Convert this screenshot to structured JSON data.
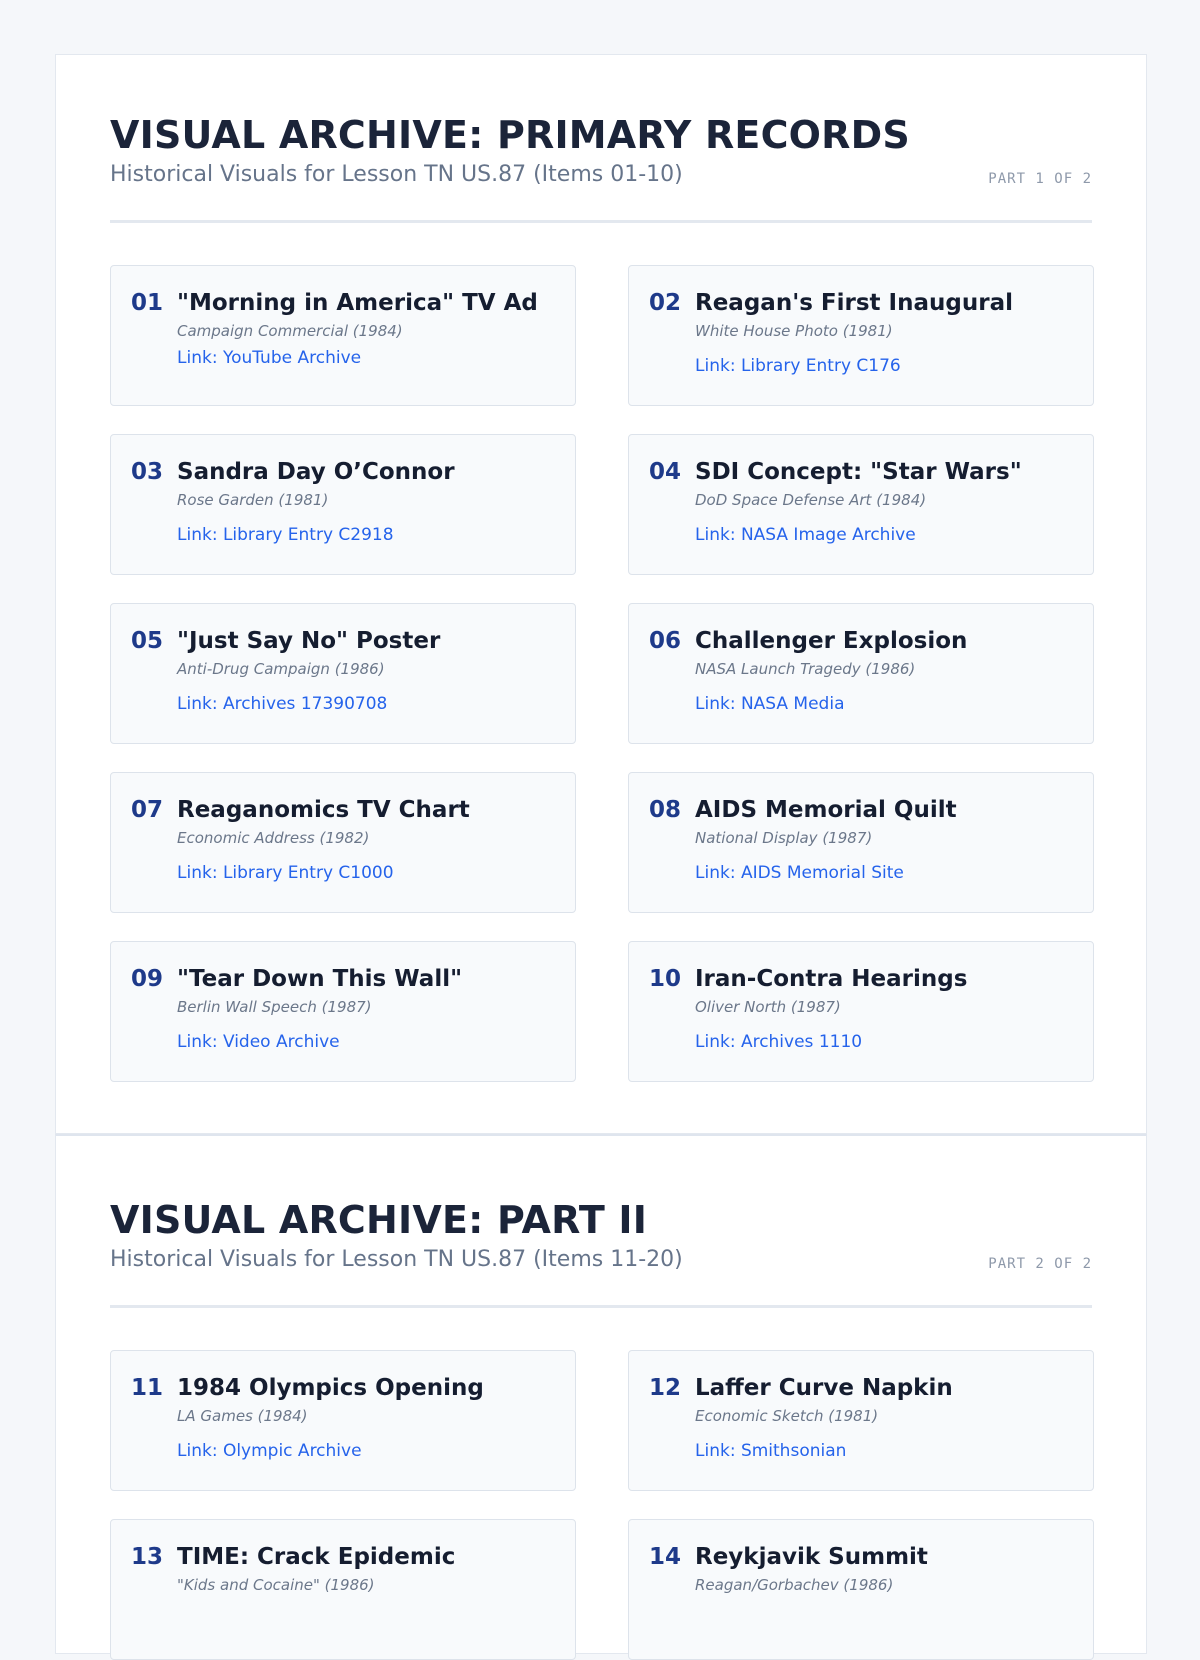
{
  "sections": [
    {
      "title": "VISUAL ARCHIVE: PRIMARY RECORDS",
      "subtitle": "Historical Visuals for Lesson TN US.87 (Items 01-10)",
      "part": "PART 1 OF 2",
      "items": [
        {
          "num": "01",
          "title": "\"Morning in America\" TV Ad",
          "meta": "Campaign Commercial (1984)",
          "link": "Link: YouTube Archive"
        },
        {
          "num": "02",
          "title": "Reagan's First Inaugural",
          "meta": "White House Photo (1981)",
          "link": "Link: Library Entry C176"
        },
        {
          "num": "03",
          "title": "Sandra Day O’Connor",
          "meta": "Rose Garden (1981)",
          "link": "Link: Library Entry C2918"
        },
        {
          "num": "04",
          "title": "SDI Concept: \"Star Wars\"",
          "meta": "DoD Space Defense Art (1984)",
          "link": "Link: NASA Image Archive"
        },
        {
          "num": "05",
          "title": "\"Just Say No\" Poster",
          "meta": "Anti-Drug Campaign (1986)",
          "link": "Link: Archives 17390708"
        },
        {
          "num": "06",
          "title": "Challenger Explosion",
          "meta": "NASA Launch Tragedy (1986)",
          "link": "Link: NASA Media"
        },
        {
          "num": "07",
          "title": "Reaganomics TV Chart",
          "meta": "Economic Address (1982)",
          "link": "Link: Library Entry C1000"
        },
        {
          "num": "08",
          "title": "AIDS Memorial Quilt",
          "meta": "National Display (1987)",
          "link": "Link: AIDS Memorial Site"
        },
        {
          "num": "09",
          "title": "\"Tear Down This Wall\"",
          "meta": "Berlin Wall Speech (1987)",
          "link": "Link: Video Archive"
        },
        {
          "num": "10",
          "title": "Iran-Contra Hearings",
          "meta": "Oliver North (1987)",
          "link": "Link: Archives 1110"
        }
      ]
    },
    {
      "title": "VISUAL ARCHIVE: PART II",
      "subtitle": "Historical Visuals for Lesson TN US.87 (Items 11-20)",
      "part": "PART 2 OF 2",
      "items": [
        {
          "num": "11",
          "title": "1984 Olympics Opening",
          "meta": "LA Games (1984)",
          "link": "Link: Olympic Archive"
        },
        {
          "num": "12",
          "title": "Laffer Curve Napkin",
          "meta": "Economic Sketch (1981)",
          "link": "Link: Smithsonian"
        },
        {
          "num": "13",
          "title": "TIME: Crack Epidemic",
          "meta": "\"Kids and Cocaine\" (1986)",
          "link": ""
        },
        {
          "num": "14",
          "title": "Reykjavik Summit",
          "meta": "Reagan/Gorbachev (1986)",
          "link": ""
        }
      ]
    }
  ]
}
